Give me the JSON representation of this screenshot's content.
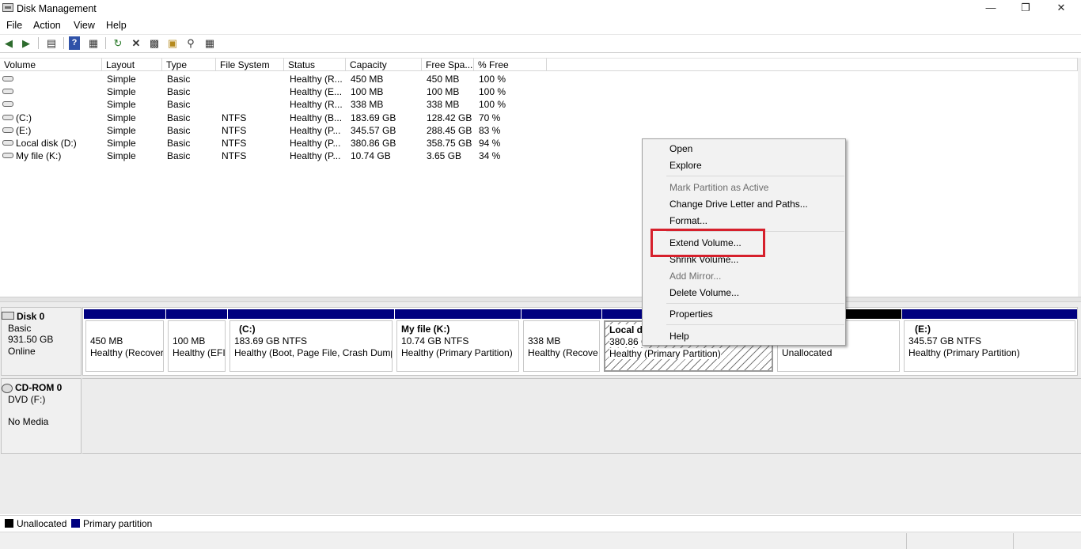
{
  "window": {
    "title": "Disk Management",
    "minimize": "—",
    "restore": "❐",
    "close": "✕"
  },
  "menu": [
    "File",
    "Action",
    "View",
    "Help"
  ],
  "toolbar_icons": [
    "back-arrow-icon",
    "forward-arrow-icon",
    "console-tree-icon",
    "help-icon",
    "show-hide-icon",
    "refresh-icon",
    "delete-icon",
    "properties-icon",
    "open-folder-icon",
    "explore-icon",
    "settings-icon"
  ],
  "columns": [
    "Volume",
    "Layout",
    "Type",
    "File System",
    "Status",
    "Capacity",
    "Free Spa...",
    "% Free"
  ],
  "rows": [
    [
      "",
      "Simple",
      "Basic",
      "",
      "Healthy (R...",
      "450 MB",
      "450 MB",
      "100 %"
    ],
    [
      "",
      "Simple",
      "Basic",
      "",
      "Healthy (E...",
      "100 MB",
      "100 MB",
      "100 %"
    ],
    [
      "",
      "Simple",
      "Basic",
      "",
      "Healthy (R...",
      "338 MB",
      "338 MB",
      "100 %"
    ],
    [
      "(C:)",
      "Simple",
      "Basic",
      "NTFS",
      "Healthy (B...",
      "183.69 GB",
      "128.42 GB",
      "70 %"
    ],
    [
      "(E:)",
      "Simple",
      "Basic",
      "NTFS",
      "Healthy (P...",
      "345.57 GB",
      "288.45 GB",
      "83 %"
    ],
    [
      "Local disk (D:)",
      "Simple",
      "Basic",
      "NTFS",
      "Healthy (P...",
      "380.86 GB",
      "358.75 GB",
      "94 %"
    ],
    [
      "My file (K:)",
      "Simple",
      "Basic",
      "NTFS",
      "Healthy (P...",
      "10.74 GB",
      "3.65 GB",
      "34 %"
    ]
  ],
  "disk0": {
    "name": "Disk 0",
    "type": "Basic",
    "size": "931.50 GB",
    "status": "Online",
    "partitions": [
      {
        "title": "",
        "size": "450 MB",
        "status": "Healthy (Recover"
      },
      {
        "title": "",
        "size": "100 MB",
        "status": "Healthy (EFI"
      },
      {
        "title": "(C:)",
        "size": "183.69 GB NTFS",
        "status": "Healthy (Boot, Page File, Crash Dump"
      },
      {
        "title": "My file  (K:)",
        "size": "10.74 GB NTFS",
        "status": "Healthy (Primary Partition)"
      },
      {
        "title": "",
        "size": "338 MB",
        "status": "Healthy (Recove"
      },
      {
        "title": "Local dis",
        "size": "380.86 G",
        "status": "Healthy (Primary Partition)"
      },
      {
        "title": "",
        "size": "",
        "status": "Unallocated"
      },
      {
        "title": "(E:)",
        "size": "345.57 GB NTFS",
        "status": "Healthy (Primary Partition)"
      }
    ]
  },
  "cdrom0": {
    "name": "CD-ROM 0",
    "drive": "DVD (F:)",
    "media": "No Media"
  },
  "legend": {
    "unallocated": "Unallocated",
    "primary": "Primary partition"
  },
  "colors": {
    "primary": "#00007f",
    "unallocated": "#000000",
    "highlight": "#d6202c"
  },
  "context_menu": [
    {
      "label": "Open",
      "enabled": true
    },
    {
      "label": "Explore",
      "enabled": true
    },
    {
      "label": "Mark Partition as Active",
      "enabled": false
    },
    {
      "label": "Change Drive Letter and Paths...",
      "enabled": true
    },
    {
      "label": "Format...",
      "enabled": true
    },
    {
      "label": "Extend Volume...",
      "enabled": true
    },
    {
      "label": "Shrink Volume...",
      "enabled": true
    },
    {
      "label": "Add Mirror...",
      "enabled": false
    },
    {
      "label": "Delete Volume...",
      "enabled": true
    },
    {
      "label": "Properties",
      "enabled": true
    },
    {
      "label": "Help",
      "enabled": true
    }
  ]
}
